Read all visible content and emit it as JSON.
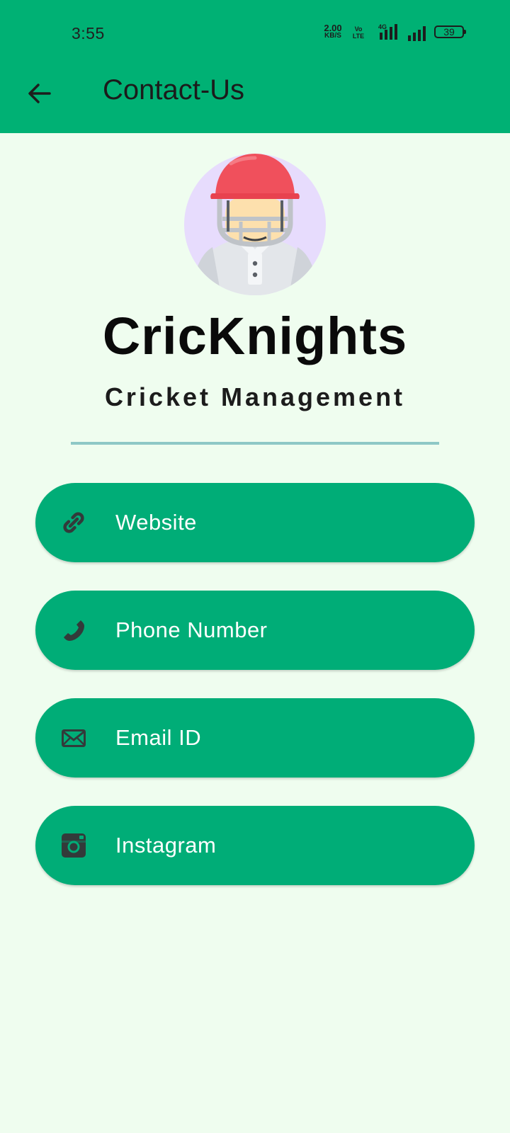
{
  "status_bar": {
    "time": "3:55",
    "net_speed_value": "2.00",
    "net_speed_unit": "KB/S",
    "volte_top": "Vo",
    "volte_bottom": "LTE",
    "network_type": "4G",
    "battery_level": "39"
  },
  "header": {
    "title": "Contact-Us",
    "back_icon": "arrow-back-icon"
  },
  "brand": {
    "name": "CricKnights",
    "subtitle": "Cricket Management"
  },
  "contacts": [
    {
      "label": "Website",
      "icon": "link-icon"
    },
    {
      "label": "Phone Number",
      "icon": "phone-icon"
    },
    {
      "label": "Email ID",
      "icon": "email-icon"
    },
    {
      "label": "Instagram",
      "icon": "instagram-icon"
    }
  ],
  "colors": {
    "appbar": "#00b174",
    "background": "#effdef",
    "button": "#00ad77",
    "divider": "#8ec8c6",
    "icon": "#333a3a"
  }
}
